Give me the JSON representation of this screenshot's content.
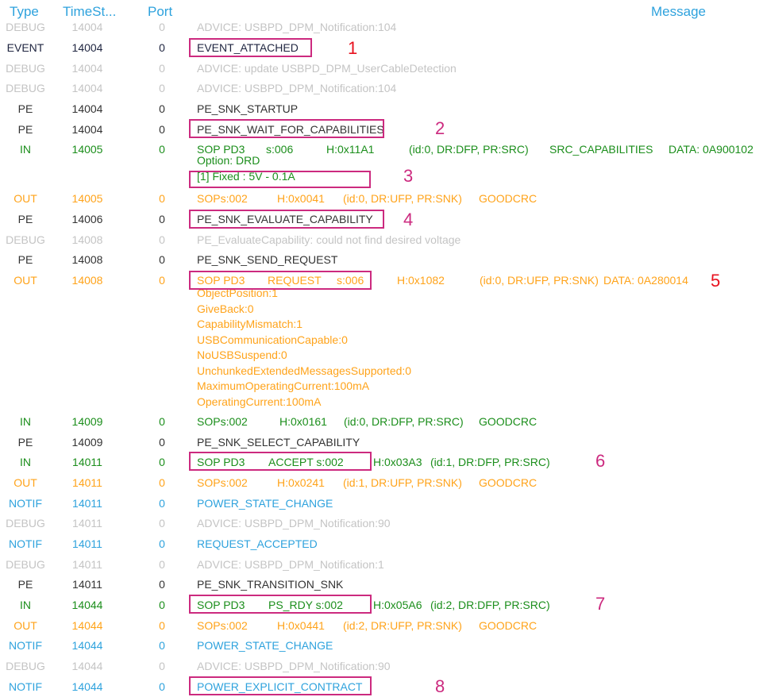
{
  "header": {
    "type": "Type",
    "time": "TimeSt...",
    "port": "Port",
    "message": "Message"
  },
  "colors": {
    "debug": "#c4c4c4",
    "event": "#1f2540",
    "pe": "#333333",
    "in": "#1b8e1b",
    "out": "#ffa31a",
    "notif": "#2ea2dd",
    "highlight": "#cc2a7f",
    "annotation_red": "#e8111e"
  },
  "rows": [
    {
      "type": "DEBUG",
      "time": "14004",
      "port": "0",
      "msg": "ADVICE: USBPD_DPM_Notification:104"
    },
    {
      "type": "EVENT",
      "time": "14004",
      "port": "0",
      "msg": "EVENT_ATTACHED"
    },
    {
      "type": "DEBUG",
      "time": "14004",
      "port": "0",
      "msg": "ADVICE: update USBPD_DPM_UserCableDetection"
    },
    {
      "type": "DEBUG",
      "time": "14004",
      "port": "0",
      "msg": "ADVICE: USBPD_DPM_Notification:104"
    },
    {
      "type": "PE",
      "time": "14004",
      "port": "0",
      "msg": "PE_SNK_STARTUP"
    },
    {
      "type": "PE",
      "time": "14004",
      "port": "0",
      "msg": "PE_SNK_WAIT_FOR_CAPABILITIES"
    },
    {
      "type": "IN",
      "time": "14005",
      "port": "0",
      "parts": [
        "SOP PD3",
        "s:006",
        "H:0x11A1",
        "(id:0, DR:DFP, PR:SRC)",
        "SRC_CAPABILITIES",
        "DATA: 0A900102"
      ],
      "sub": [
        "Option:   DRD",
        "[1] Fixed : 5V - 0.1A"
      ]
    },
    {
      "type": "OUT",
      "time": "14005",
      "port": "0",
      "parts": [
        "SOPs:002",
        "H:0x0041",
        "(id:0, DR:UFP, PR:SNK)",
        "GOODCRC"
      ]
    },
    {
      "type": "PE",
      "time": "14006",
      "port": "0",
      "msg": "PE_SNK_EVALUATE_CAPABILITY"
    },
    {
      "type": "DEBUG",
      "time": "14008",
      "port": "0",
      "msg": "PE_EvaluateCapability: could not find desired voltage"
    },
    {
      "type": "PE",
      "time": "14008",
      "port": "0",
      "msg": "PE_SNK_SEND_REQUEST"
    },
    {
      "type": "OUT",
      "time": "14008",
      "port": "0",
      "parts": [
        "SOP PD3",
        "REQUEST",
        "s:006",
        "H:0x1082",
        "(id:0, DR:UFP, PR:SNK)",
        "DATA: 0A280014"
      ],
      "sub": [
        "ObjectPosition:1",
        "GiveBack:0",
        "CapabilityMismatch:1",
        "USBCommunicationCapable:0",
        "NoUSBSuspend:0",
        "UnchunkedExtendedMessagesSupported:0",
        "MaximumOperatingCurrent:100mA",
        "OperatingCurrent:100mA"
      ]
    },
    {
      "type": "IN",
      "time": "14009",
      "port": "0",
      "parts": [
        "SOPs:002",
        "H:0x0161",
        "(id:0, DR:DFP, PR:SRC)",
        "GOODCRC"
      ]
    },
    {
      "type": "PE",
      "time": "14009",
      "port": "0",
      "msg": "PE_SNK_SELECT_CAPABILITY"
    },
    {
      "type": "IN",
      "time": "14011",
      "port": "0",
      "parts": [
        "SOP PD3",
        "ACCEPT s:002",
        "H:0x03A3",
        "(id:1, DR:DFP, PR:SRC)"
      ]
    },
    {
      "type": "OUT",
      "time": "14011",
      "port": "0",
      "parts": [
        "SOPs:002",
        "H:0x0241",
        "(id:1, DR:UFP, PR:SNK)",
        "GOODCRC"
      ]
    },
    {
      "type": "NOTIF",
      "time": "14011",
      "port": "0",
      "msg": "POWER_STATE_CHANGE"
    },
    {
      "type": "DEBUG",
      "time": "14011",
      "port": "0",
      "msg": "ADVICE: USBPD_DPM_Notification:90"
    },
    {
      "type": "NOTIF",
      "time": "14011",
      "port": "0",
      "msg": "REQUEST_ACCEPTED"
    },
    {
      "type": "DEBUG",
      "time": "14011",
      "port": "0",
      "msg": "ADVICE: USBPD_DPM_Notification:1"
    },
    {
      "type": "PE",
      "time": "14011",
      "port": "0",
      "msg": "PE_SNK_TRANSITION_SNK"
    },
    {
      "type": "IN",
      "time": "14044",
      "port": "0",
      "parts": [
        "SOP PD3",
        "PS_RDY s:002",
        "H:0x05A6",
        "(id:2, DR:DFP, PR:SRC)"
      ]
    },
    {
      "type": "OUT",
      "time": "14044",
      "port": "0",
      "parts": [
        "SOPs:002",
        "H:0x0441",
        "(id:2, DR:UFP, PR:SNK)",
        "GOODCRC"
      ]
    },
    {
      "type": "NOTIF",
      "time": "14044",
      "port": "0",
      "msg": "POWER_STATE_CHANGE"
    },
    {
      "type": "DEBUG",
      "time": "14044",
      "port": "0",
      "msg": "ADVICE: USBPD_DPM_Notification:90"
    },
    {
      "type": "NOTIF",
      "time": "14044",
      "port": "0",
      "msg": "POWER_EXPLICIT_CONTRACT"
    }
  ],
  "annotations": [
    "1",
    "2",
    "3",
    "4",
    "5",
    "6",
    "7",
    "8"
  ]
}
